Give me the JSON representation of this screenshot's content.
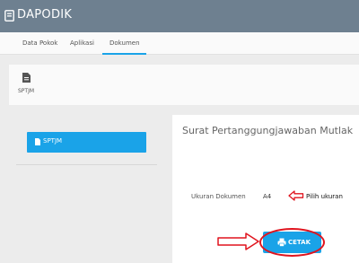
{
  "app": {
    "title": "DAPODIK",
    "logo_icon": "app-logo-icon"
  },
  "nav": {
    "tabs": [
      {
        "label": "Data Pokok"
      },
      {
        "label": "Aplikasi"
      },
      {
        "label": "Dokumen",
        "active": true
      }
    ],
    "active_color": "#1aa3e8"
  },
  "shortcut": {
    "label": "SPTJM",
    "icon": "document-icon"
  },
  "sidebar": {
    "button_label": "SPTJM",
    "icon": "document-icon"
  },
  "form": {
    "title": "Surat Pertanggungjawaban Mutlak",
    "field_label": "Ukuran Dokumen",
    "field_value": "A4",
    "annotation": "Pilih ukuran",
    "print_button": "CETAK",
    "print_icon": "printer-icon"
  },
  "colors": {
    "topbar": "#6e8090",
    "accent": "#1aa3e8",
    "annotation": "#e0141e"
  }
}
